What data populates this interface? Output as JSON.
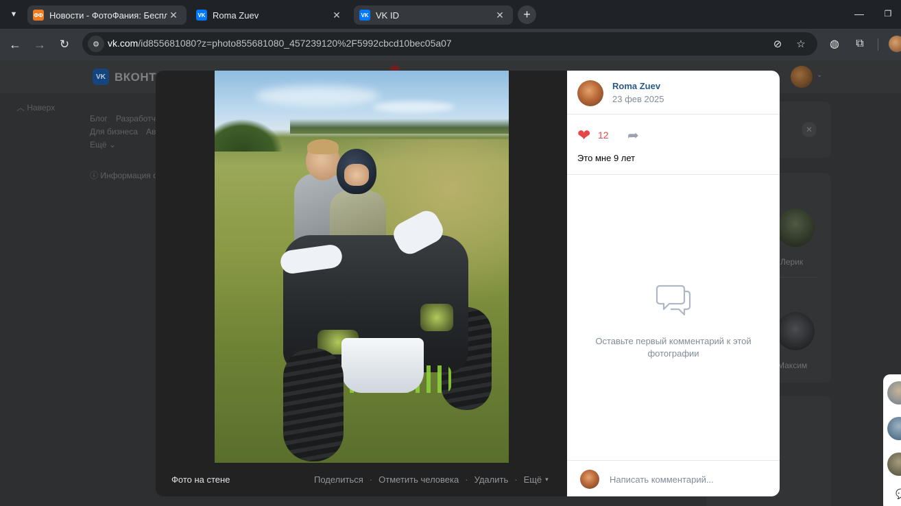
{
  "browser": {
    "tabs": [
      {
        "title": "Новости - ФотоФания: Беспла",
        "favicon": "fotofania-icon",
        "favicon_text": "ФФ",
        "active": false
      },
      {
        "title": "Roma Zuev",
        "favicon": "vk-icon",
        "favicon_text": "VK",
        "active": true
      },
      {
        "title": "VK ID",
        "favicon": "vk-icon",
        "favicon_text": "VK",
        "active": false
      }
    ],
    "url_host": "vk.com",
    "url_path": "/id855681080?z=photo855681080_457239120%2F5992cbcd10bec05a07"
  },
  "vk_page": {
    "logo_text": "ВКОНТ",
    "logo_badge": "VK",
    "back_link": "Наверх",
    "footer_links_row1": [
      "Блог",
      "Разработч"
    ],
    "footer_links_row2": [
      "Для бизнеса",
      "Ав"
    ],
    "footer_more": "Ещё ⌄",
    "info_link": "ⓘ Информация о",
    "friends": [
      {
        "name": "Лерик"
      },
      {
        "name": "Максим"
      }
    ]
  },
  "viewer": {
    "album_label": "Фото на стене",
    "actions": {
      "share": "Поделиться",
      "tag": "Отметить человека",
      "delete": "Удалить",
      "more": "Ещё"
    },
    "author": {
      "name": "Roma Zuev",
      "date": "23 фев 2025"
    },
    "likes": "12",
    "caption": "Это мне 9 лет",
    "empty_comments": "Оставьте первый комментарий к этой фотографии",
    "comment_placeholder": "Написать комментарий..."
  },
  "colors": {
    "accent_link": "#2a5885",
    "like_red": "#e64646",
    "secondary_text": "#818c99"
  }
}
